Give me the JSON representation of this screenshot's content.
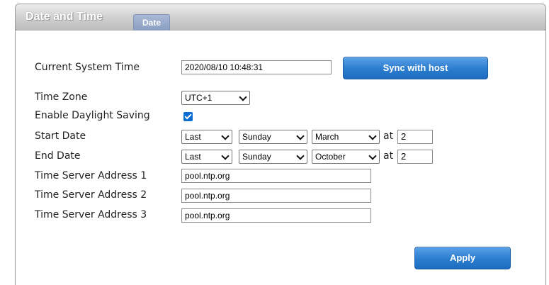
{
  "panel": {
    "title": "Date and Time",
    "tab_label": "Date"
  },
  "form": {
    "current_time": {
      "label": "Current System Time",
      "value": "2020/08/10 10:48:31",
      "sync_button": "Sync with host"
    },
    "time_zone": {
      "label": "Time Zone",
      "selected": "UTC+1"
    },
    "dst": {
      "label": "Enable Daylight Saving",
      "checked": true
    },
    "start_date": {
      "label": "Start Date",
      "week": "Last",
      "day": "Sunday",
      "month": "March",
      "at_label": "at",
      "hour": "2"
    },
    "end_date": {
      "label": "End Date",
      "week": "Last",
      "day": "Sunday",
      "month": "October",
      "at_label": "at",
      "hour": "2"
    },
    "server1": {
      "label": "Time Server Address 1",
      "value": "pool.ntp.org"
    },
    "server2": {
      "label": "Time Server Address 2",
      "value": "pool.ntp.org"
    },
    "server3": {
      "label": "Time Server Address 3",
      "value": "pool.ntp.org"
    },
    "apply_button": "Apply"
  },
  "colors": {
    "button_blue": "#2f7fd0",
    "tab_blue": "#8a9ec2",
    "checkbox_blue": "#0a6ed1"
  }
}
